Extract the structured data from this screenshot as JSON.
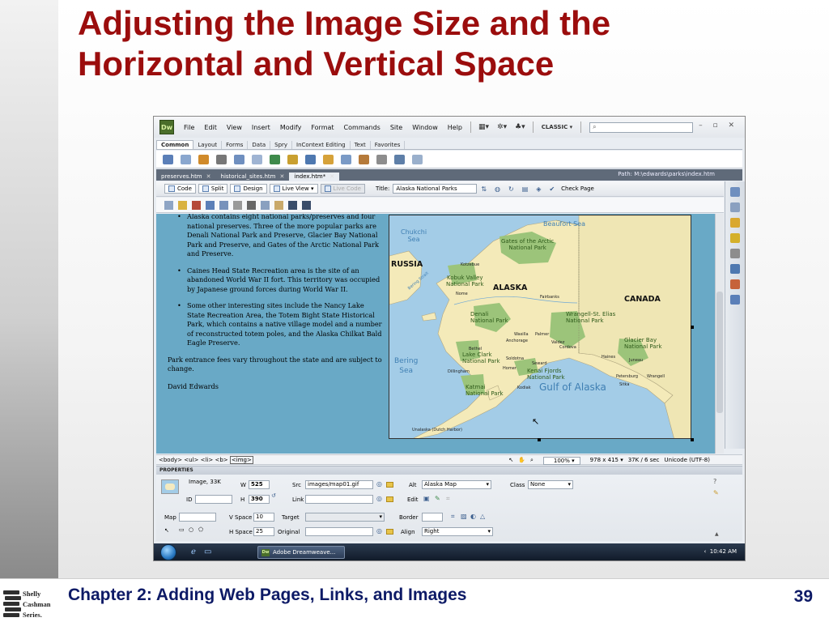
{
  "slide": {
    "title_line1": "Adjusting the Image Size and the",
    "title_line2": "Horizontal and Vertical Space",
    "footer": "Chapter 2: Adding Web Pages, Links, and Images",
    "page_number": "39",
    "logo_lines": [
      "Shelly",
      "Cashman",
      "Series."
    ],
    "colors": {
      "title": "#9b0d0d",
      "footer": "#0d1a66"
    }
  },
  "app": {
    "logo": "Dw",
    "menu": [
      "File",
      "Edit",
      "View",
      "Insert",
      "Modify",
      "Format",
      "Commands",
      "Site",
      "Window",
      "Help"
    ],
    "workspace": "CLASSIC",
    "window_controls": "– ▫ ✕",
    "insert_tabs": [
      "Common",
      "Layout",
      "Forms",
      "Data",
      "Spry",
      "InContext Editing",
      "Text",
      "Favorites"
    ],
    "doc_tabs": [
      "preserves.htm",
      "historical_sites.htm",
      "index.htm*"
    ],
    "path": "Path: M:\\edwards\\parks\\index.htm",
    "views": {
      "code": "Code",
      "split": "Split",
      "design": "Design",
      "live_view": "Live View",
      "live_code": "Live Code"
    },
    "title_label": "Title:",
    "title_value": "Alaska National Parks",
    "check_page": "Check Page"
  },
  "content": {
    "bullets": [
      "Alaska contains eight national parks/preserves and four national preserves. Three of the more popular parks are Denali National Park and Preserve, Glacier Bay National Park and Preserve, and Gates of the Arctic National Park and Preserve.",
      "Caines Head State Recreation area is the site of an abandoned World War II fort. This territory was occupied by Japanese ground forces during World War II.",
      "Some other interesting sites include the Nancy Lake State Recreation Area, the Totem Bight State Historical Park, which contains a native village model and a number of reconstructed totem poles, and the Alaska Chilkat Bald Eagle Preserve."
    ],
    "paragraph": "Park entrance fees vary throughout the state and are subject to change.",
    "cut_text": "David Edwards"
  },
  "map": {
    "seas": {
      "chukchi": "Chukchi\nSea",
      "beaufort": "Beaufort Sea",
      "bering": "Bering\nSea",
      "gulf": "Gulf of Alaska",
      "bering_strait": "Bering Strait"
    },
    "countries": {
      "russia": "RUSSIA",
      "alaska": "ALASKA",
      "canada": "CANADA"
    },
    "parks": {
      "gates": "Gates of the Arctic\nNational Park",
      "kobuk": "Kobuk Valley\nNational Park",
      "denali": "Denali\nNational Park",
      "wrangell": "Wrangell-St. Elias\nNational Park",
      "glacier": "Glacier Bay\nNational Park",
      "lake_clark": "Lake Clark\nNational Park",
      "kenai": "Kenai Fjords\nNational Park",
      "katmai": "Katmai\nNational Park"
    },
    "towns": [
      "Kotzebue",
      "Nome",
      "Fairbanks",
      "Wasilla",
      "Palmer",
      "Anchorage",
      "Valdez",
      "Cordova",
      "Bethel",
      "Soldotna",
      "Homer",
      "Seward",
      "Dillingham",
      "Kodiak",
      "Haines",
      "Juneau",
      "Petersburg",
      "Wrangell",
      "Sitka",
      "Unalaska (Dutch Harbor)"
    ]
  },
  "statusbar": {
    "tags": [
      "<body>",
      "<ul>",
      "<li>",
      "<b>",
      "<img>"
    ],
    "zoom": "100%",
    "dimensions": "978 x 415 ▾",
    "size_time": "37K / 6 sec",
    "encoding": "Unicode (UTF-8)"
  },
  "properties": {
    "header": "PROPERTIES",
    "image_label": "Image, 33K",
    "w_label": "W",
    "w_value": "525",
    "h_label": "H",
    "h_value": "390",
    "id_label": "ID",
    "id_value": "",
    "src_label": "Src",
    "src_value": "images/map01.gif",
    "link_label": "Link",
    "link_value": "",
    "alt_label": "Alt",
    "alt_value": "Alaska Map",
    "edit_label": "Edit",
    "class_label": "Class",
    "class_value": "None",
    "map_label": "Map",
    "map_value": "",
    "vspace_label": "V Space",
    "vspace_value": "10",
    "target_label": "Target",
    "target_value": "",
    "border_label": "Border",
    "border_value": "",
    "hspace_label": "H Space",
    "hspace_value": "25",
    "original_label": "Original",
    "original_value": "",
    "align_label": "Align",
    "align_value": "Right"
  },
  "taskbar": {
    "task_label": "Adobe Dreamweave...",
    "clock": "10:42 AM",
    "tray": "‹"
  }
}
